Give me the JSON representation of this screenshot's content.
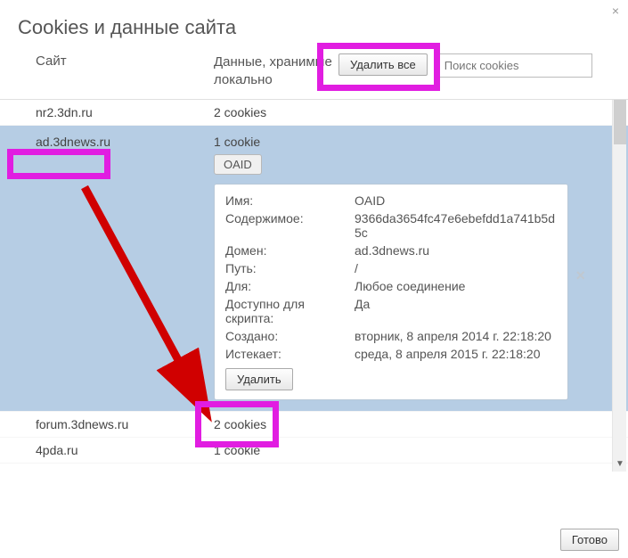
{
  "dialog": {
    "title": "Cookies и данные сайта",
    "close_x": "×"
  },
  "columns": {
    "site": "Сайт",
    "data": "Данные, хранимые локально"
  },
  "toolbar": {
    "delete_all": "Удалить все"
  },
  "search": {
    "placeholder": "Поиск cookies"
  },
  "rows": {
    "r0": {
      "site": "nr2.3dn.ru",
      "data": "2 cookies"
    },
    "r1": {
      "site": "ad.3dnews.ru",
      "data": "1 cookie"
    },
    "r2": {
      "site": "forum.3dnews.ru",
      "data": "2 cookies"
    },
    "r3": {
      "site": "4pda.ru",
      "data": "1 cookie"
    }
  },
  "cookie_chip": "OAID",
  "detail": {
    "close": "×",
    "name_k": "Имя:",
    "name_v": "OAID",
    "content_k": "Содержимое:",
    "content_v": "9366da3654fc47e6ebefdd1a741b5d5c",
    "domain_k": "Домен:",
    "domain_v": "ad.3dnews.ru",
    "path_k": "Путь:",
    "path_v": "/",
    "for_k": "Для:",
    "for_v": "Любое соединение",
    "script_k": "Доступно для скрипта:",
    "script_v": "Да",
    "created_k": "Создано:",
    "created_v": "вторник, 8 апреля 2014 г. 22:18:20",
    "expires_k": "Истекает:",
    "expires_v": "среда, 8 апреля 2015 г. 22:18:20",
    "delete": "Удалить"
  },
  "footer": {
    "done": "Готово"
  },
  "scrollbar": {
    "up": "▲",
    "down": "▼"
  }
}
